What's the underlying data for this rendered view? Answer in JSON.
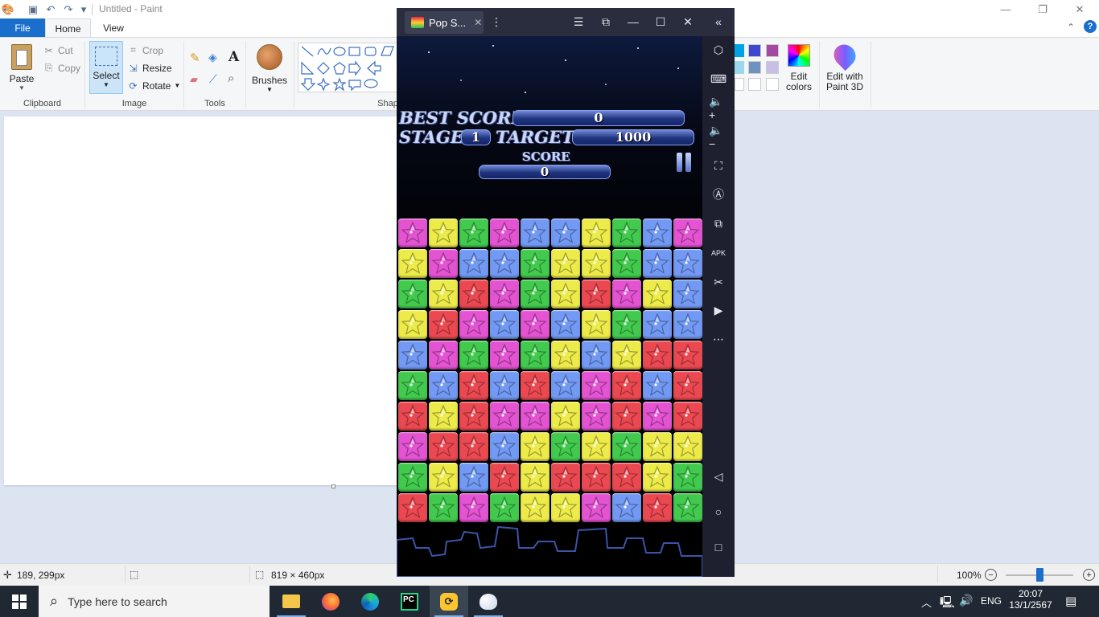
{
  "paint": {
    "title": "Untitled - Paint",
    "tabs": [
      "File",
      "Home",
      "View"
    ],
    "clipboard": {
      "paste": "Paste",
      "cut": "Cut",
      "copy": "Copy",
      "group": "Clipboard"
    },
    "image": {
      "select": "Select",
      "crop": "Crop",
      "resize": "Resize",
      "rotate": "Rotate",
      "group": "Image"
    },
    "tools": {
      "group": "Tools"
    },
    "brushes": {
      "label": "Brushes"
    },
    "shapes": {
      "group": "Shap"
    },
    "colors": {
      "edit_colors_1": "Edit",
      "edit_colors_2": "colors",
      "paint3d_1": "Edit with",
      "paint3d_2": "Paint 3D"
    },
    "status": {
      "cursor": "189, 299px",
      "size": "819 × 460px",
      "zoom": "100%"
    }
  },
  "emulator": {
    "tab_title": "Pop S...",
    "side_icons": [
      "settings-hex-icon",
      "keyboard-icon",
      "volume-up-icon",
      "volume-down-icon",
      "screenshot-icon",
      "rotate-icon",
      "multi-instance-icon",
      "apk-icon",
      "scissors-icon",
      "record-icon",
      "more-icon"
    ],
    "nav_icons": [
      "back-icon",
      "home-icon",
      "recent-icon"
    ]
  },
  "game": {
    "best_score_label": "BEST SCORE",
    "best_score": "0",
    "stage_label": "STAGE",
    "stage": "1",
    "target_label": "TARGET",
    "target": "1000",
    "score_label": "SCORE",
    "score": "0",
    "colors": {
      "P": "#d84fc8",
      "Y": "#e2e046",
      "G": "#3fc04a",
      "B": "#6d92e8",
      "R": "#e0454d"
    },
    "grid": [
      "PYGPBBYGBP",
      "YPBBGYYGBB",
      "GYRPGYRPYB",
      "YRPBPBYGBB",
      "BPGPGYBYRR",
      "GBRBRBPRBR",
      "RYRPPYPRPR",
      "PRRBYGYGYY",
      "GYBRYRRRYG",
      "RGPGYYPBRG"
    ]
  },
  "taskbar": {
    "search_placeholder": "Type here to search",
    "language": "ENG",
    "time": "20:07",
    "date": "13/1/2567"
  }
}
